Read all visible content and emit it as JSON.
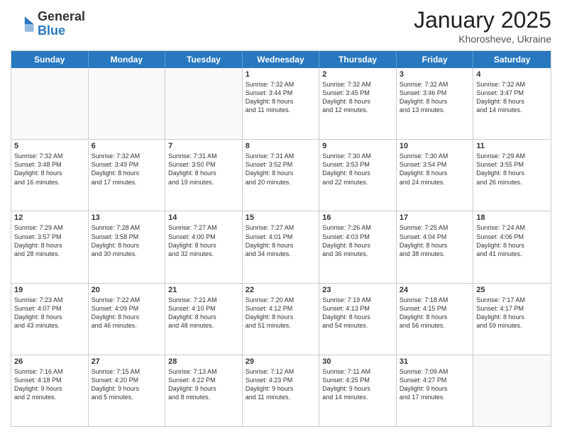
{
  "logo": {
    "general": "General",
    "blue": "Blue"
  },
  "title": "January 2025",
  "location": "Khorosheve, Ukraine",
  "days": [
    "Sunday",
    "Monday",
    "Tuesday",
    "Wednesday",
    "Thursday",
    "Friday",
    "Saturday"
  ],
  "weeks": [
    [
      {
        "day": "",
        "info": ""
      },
      {
        "day": "",
        "info": ""
      },
      {
        "day": "",
        "info": ""
      },
      {
        "day": "1",
        "info": "Sunrise: 7:32 AM\nSunset: 3:44 PM\nDaylight: 8 hours\nand 11 minutes."
      },
      {
        "day": "2",
        "info": "Sunrise: 7:32 AM\nSunset: 3:45 PM\nDaylight: 8 hours\nand 12 minutes."
      },
      {
        "day": "3",
        "info": "Sunrise: 7:32 AM\nSunset: 3:46 PM\nDaylight: 8 hours\nand 13 minutes."
      },
      {
        "day": "4",
        "info": "Sunrise: 7:32 AM\nSunset: 3:47 PM\nDaylight: 8 hours\nand 14 minutes."
      }
    ],
    [
      {
        "day": "5",
        "info": "Sunrise: 7:32 AM\nSunset: 3:48 PM\nDaylight: 8 hours\nand 16 minutes."
      },
      {
        "day": "6",
        "info": "Sunrise: 7:32 AM\nSunset: 3:49 PM\nDaylight: 8 hours\nand 17 minutes."
      },
      {
        "day": "7",
        "info": "Sunrise: 7:31 AM\nSunset: 3:50 PM\nDaylight: 8 hours\nand 19 minutes."
      },
      {
        "day": "8",
        "info": "Sunrise: 7:31 AM\nSunset: 3:52 PM\nDaylight: 8 hours\nand 20 minutes."
      },
      {
        "day": "9",
        "info": "Sunrise: 7:30 AM\nSunset: 3:53 PM\nDaylight: 8 hours\nand 22 minutes."
      },
      {
        "day": "10",
        "info": "Sunrise: 7:30 AM\nSunset: 3:54 PM\nDaylight: 8 hours\nand 24 minutes."
      },
      {
        "day": "11",
        "info": "Sunrise: 7:29 AM\nSunset: 3:55 PM\nDaylight: 8 hours\nand 26 minutes."
      }
    ],
    [
      {
        "day": "12",
        "info": "Sunrise: 7:29 AM\nSunset: 3:57 PM\nDaylight: 8 hours\nand 28 minutes."
      },
      {
        "day": "13",
        "info": "Sunrise: 7:28 AM\nSunset: 3:58 PM\nDaylight: 8 hours\nand 30 minutes."
      },
      {
        "day": "14",
        "info": "Sunrise: 7:27 AM\nSunset: 4:00 PM\nDaylight: 8 hours\nand 32 minutes."
      },
      {
        "day": "15",
        "info": "Sunrise: 7:27 AM\nSunset: 4:01 PM\nDaylight: 8 hours\nand 34 minutes."
      },
      {
        "day": "16",
        "info": "Sunrise: 7:26 AM\nSunset: 4:03 PM\nDaylight: 8 hours\nand 36 minutes."
      },
      {
        "day": "17",
        "info": "Sunrise: 7:25 AM\nSunset: 4:04 PM\nDaylight: 8 hours\nand 38 minutes."
      },
      {
        "day": "18",
        "info": "Sunrise: 7:24 AM\nSunset: 4:06 PM\nDaylight: 8 hours\nand 41 minutes."
      }
    ],
    [
      {
        "day": "19",
        "info": "Sunrise: 7:23 AM\nSunset: 4:07 PM\nDaylight: 8 hours\nand 43 minutes."
      },
      {
        "day": "20",
        "info": "Sunrise: 7:22 AM\nSunset: 4:09 PM\nDaylight: 8 hours\nand 46 minutes."
      },
      {
        "day": "21",
        "info": "Sunrise: 7:21 AM\nSunset: 4:10 PM\nDaylight: 8 hours\nand 48 minutes."
      },
      {
        "day": "22",
        "info": "Sunrise: 7:20 AM\nSunset: 4:12 PM\nDaylight: 8 hours\nand 51 minutes."
      },
      {
        "day": "23",
        "info": "Sunrise: 7:19 AM\nSunset: 4:13 PM\nDaylight: 8 hours\nand 54 minutes."
      },
      {
        "day": "24",
        "info": "Sunrise: 7:18 AM\nSunset: 4:15 PM\nDaylight: 8 hours\nand 56 minutes."
      },
      {
        "day": "25",
        "info": "Sunrise: 7:17 AM\nSunset: 4:17 PM\nDaylight: 8 hours\nand 59 minutes."
      }
    ],
    [
      {
        "day": "26",
        "info": "Sunrise: 7:16 AM\nSunset: 4:18 PM\nDaylight: 9 hours\nand 2 minutes."
      },
      {
        "day": "27",
        "info": "Sunrise: 7:15 AM\nSunset: 4:20 PM\nDaylight: 9 hours\nand 5 minutes."
      },
      {
        "day": "28",
        "info": "Sunrise: 7:13 AM\nSunset: 4:22 PM\nDaylight: 9 hours\nand 8 minutes."
      },
      {
        "day": "29",
        "info": "Sunrise: 7:12 AM\nSunset: 4:23 PM\nDaylight: 9 hours\nand 11 minutes."
      },
      {
        "day": "30",
        "info": "Sunrise: 7:11 AM\nSunset: 4:25 PM\nDaylight: 9 hours\nand 14 minutes."
      },
      {
        "day": "31",
        "info": "Sunrise: 7:09 AM\nSunset: 4:27 PM\nDaylight: 9 hours\nand 17 minutes."
      },
      {
        "day": "",
        "info": ""
      }
    ]
  ]
}
